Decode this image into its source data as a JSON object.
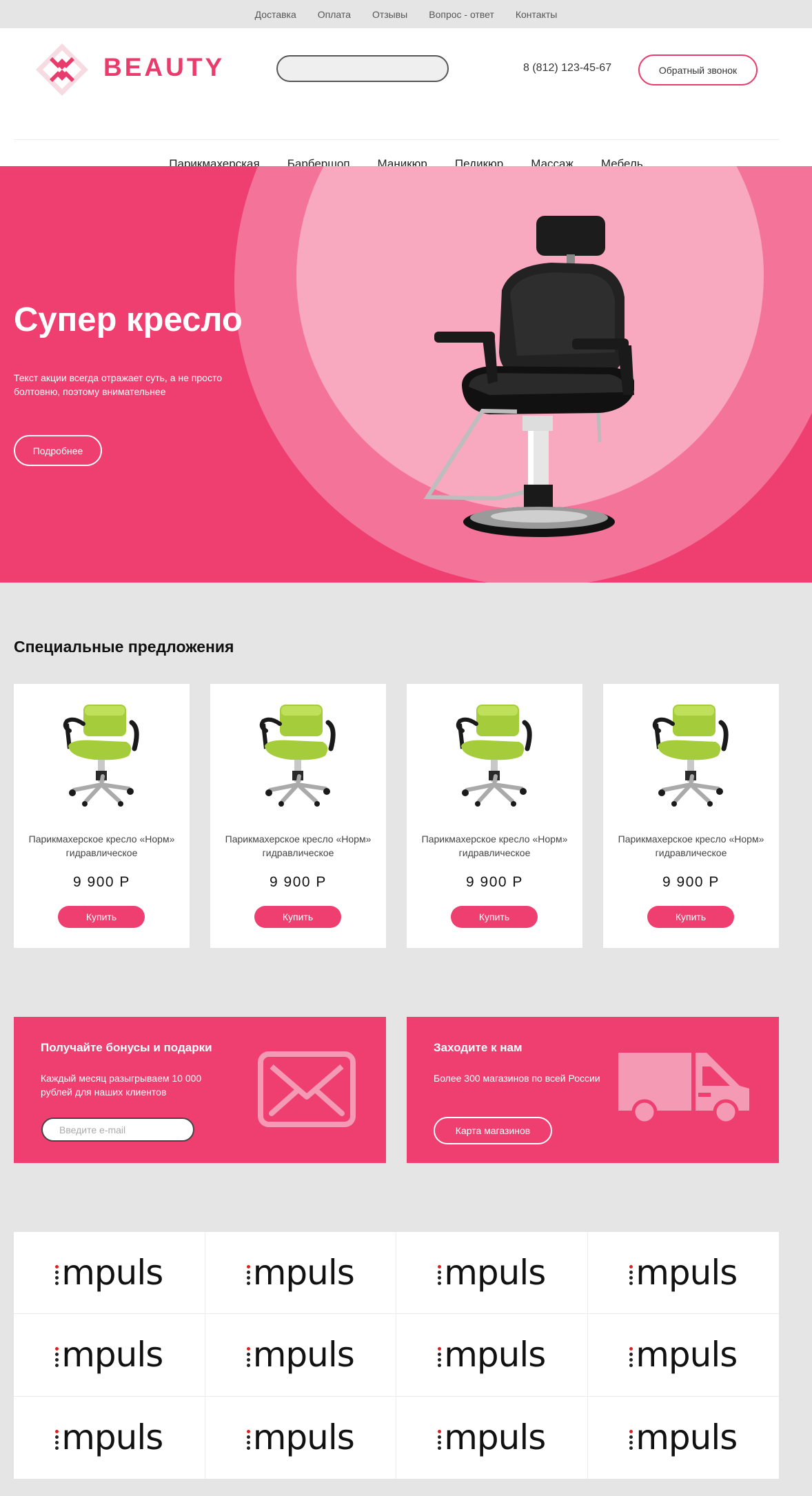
{
  "topnav": [
    "Доставка",
    "Оплата",
    "Отзывы",
    "Вопрос - ответ",
    "Контакты"
  ],
  "header": {
    "brand": "BEAUTY",
    "phone": "8 (812) 123-45-67",
    "callback_label": "Обратный звонок",
    "search_placeholder": ""
  },
  "mainnav": [
    "Парикмахерская",
    "Барбершоп",
    "Маникюр",
    "Педикюр",
    "Массаж",
    "Мебель"
  ],
  "hero": {
    "title": "Супер кресло",
    "text": "Текст акции всегда отражает суть, а не просто болтовню, поэтому внимательнее",
    "button": "Подробнее"
  },
  "specials": {
    "title": "Специальные предложения",
    "products": [
      {
        "name": "Парикмахерское кресло «Норм» гидравлическое",
        "price": "9 900 Р",
        "buy": "Купить"
      },
      {
        "name": "Парикмахерское кресло «Норм» гидравлическое",
        "price": "9 900 Р",
        "buy": "Купить"
      },
      {
        "name": "Парикмахерское кресло «Норм» гидравлическое",
        "price": "9 900 Р",
        "buy": "Купить"
      },
      {
        "name": "Парикмахерское кресло «Норм» гидравлическое",
        "price": "9 900 Р",
        "buy": "Купить"
      }
    ]
  },
  "promo_bonus": {
    "title": "Получайте бонусы и подарки",
    "text": "Каждый месяц разыгрываем 10 000 рублей для наших клиентов",
    "email_placeholder": "Введите e-mail"
  },
  "promo_stores": {
    "title": "Заходите к нам",
    "text": "Более 300 магазинов по всей России",
    "button": "Карта магазинов"
  },
  "partners": [
    "mpuls",
    "mpuls",
    "mpuls",
    "mpuls",
    "mpuls",
    "mpuls",
    "mpuls",
    "mpuls",
    "mpuls",
    "mpuls",
    "mpuls",
    "mpuls"
  ],
  "colors": {
    "accent": "#ef3e70",
    "accent_light": "#f8a8bf",
    "page_bg": "#e5e5e5"
  }
}
